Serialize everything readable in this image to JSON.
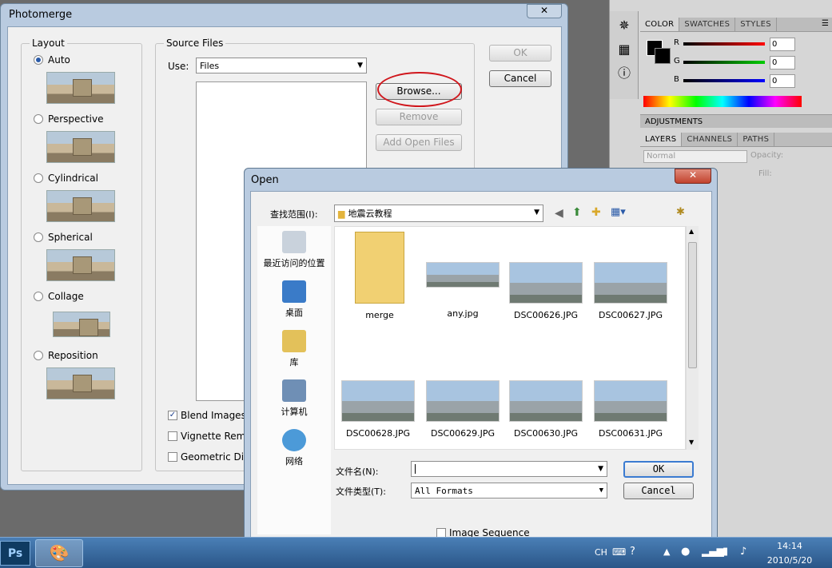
{
  "photoshop": {
    "tabs_top": [
      "COLOR",
      "SWATCHES",
      "STYLES"
    ],
    "adjustments": "ADJUSTMENTS",
    "tabs_layers": [
      "LAYERS",
      "CHANNELS",
      "PATHS"
    ],
    "blend_mode": "Normal",
    "opacity_label": "Opacity:",
    "fill_label": "Fill:",
    "r_label": "R",
    "g_label": "G",
    "b_label": "B",
    "r_value": "0",
    "g_value": "0",
    "b_value": "0"
  },
  "photomerge": {
    "title": "Photomerge",
    "layout_title": "Layout",
    "layouts": [
      "Auto",
      "Perspective",
      "Cylindrical",
      "Spherical",
      "Collage",
      "Reposition"
    ],
    "source_title": "Source Files",
    "use_label": "Use:",
    "use_value": "Files",
    "browse": "Browse...",
    "remove": "Remove",
    "add_open": "Add Open Files",
    "ok": "OK",
    "cancel": "Cancel",
    "blend": "Blend Images",
    "vignette": "Vignette Rem",
    "geometric": "Geometric Dist"
  },
  "open_dialog": {
    "title": "Open",
    "look_in_label": "查找范围(I):",
    "look_in_value": "地震云教程",
    "places": [
      "最近访问的位置",
      "桌面",
      "库",
      "计算机",
      "网络"
    ],
    "files": [
      "merge",
      "any.jpg",
      "DSC00626.JPG",
      "DSC00627.JPG",
      "DSC00628.JPG",
      "DSC00629.JPG",
      "DSC00630.JPG",
      "DSC00631.JPG"
    ],
    "filename_label": "文件名(N):",
    "filetype_label": "文件类型(T):",
    "filetype_value": "All Formats",
    "ok": "OK",
    "cancel": "Cancel",
    "image_sequence": "Image Sequence"
  },
  "taskbar": {
    "ps": "Ps",
    "lang": "CH",
    "time": "14:14",
    "date": "2010/5/20"
  }
}
